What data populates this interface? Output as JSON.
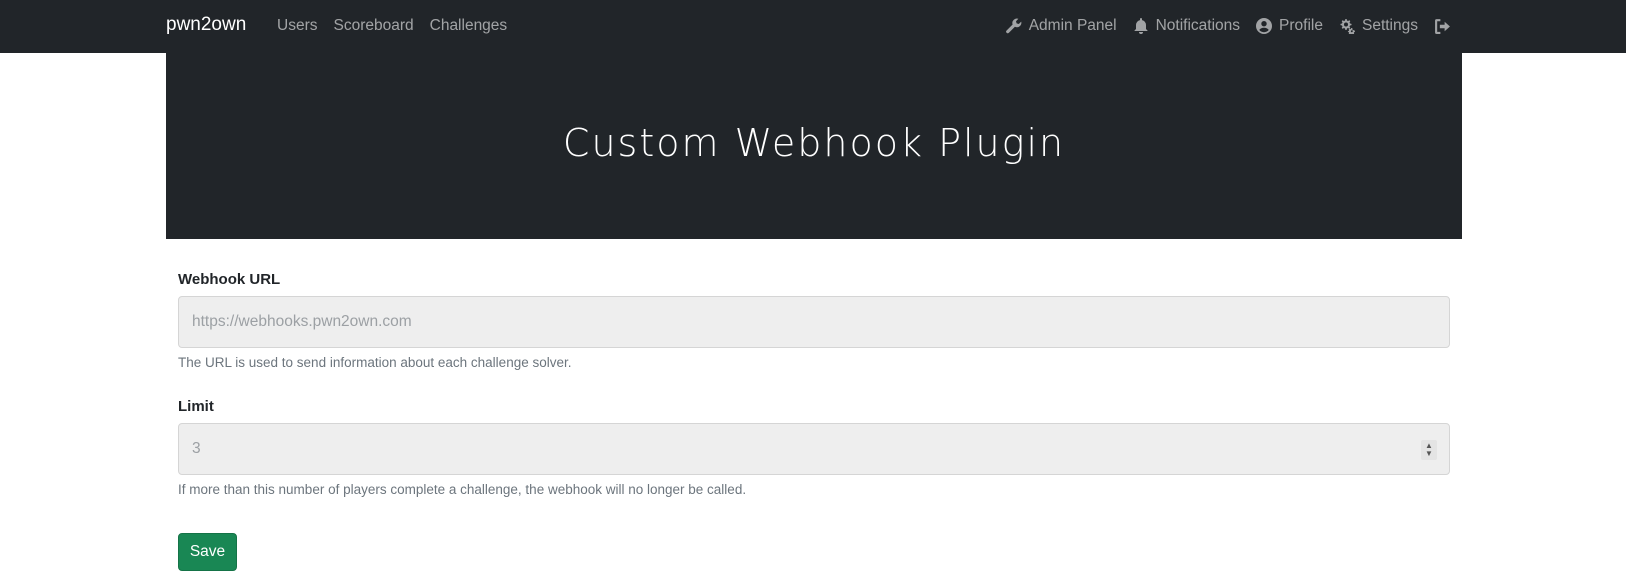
{
  "navbar": {
    "brand": "pwn2own",
    "left_links": [
      "Users",
      "Scoreboard",
      "Challenges"
    ],
    "right_links": [
      {
        "label": "Admin Panel",
        "icon": "wrench-icon"
      },
      {
        "label": "Notifications",
        "icon": "bell-icon"
      },
      {
        "label": "Profile",
        "icon": "user-circle-icon"
      },
      {
        "label": "Settings",
        "icon": "cogs-icon"
      }
    ],
    "logout_icon": "sign-out-icon"
  },
  "page": {
    "title": "Custom Webhook Plugin"
  },
  "form": {
    "webhook_url": {
      "label": "Webhook URL",
      "value": "",
      "placeholder": "https://webhooks.pwn2own.com",
      "help": "The URL is used to send information about each challenge solver."
    },
    "limit": {
      "label": "Limit",
      "value": "",
      "placeholder": "3",
      "help": "If more than this number of players complete a challenge, the webhook will no longer be called."
    },
    "save_label": "Save"
  },
  "colors": {
    "navbar_bg": "#212529",
    "save_button": "#198754"
  }
}
